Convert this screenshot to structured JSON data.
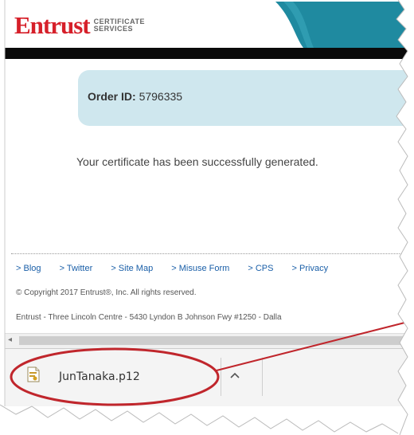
{
  "header": {
    "logo_word": "Entrust",
    "logo_sub_line1": "CERTIFICATE",
    "logo_sub_line2": "SERVICES"
  },
  "order": {
    "label": "Order ID:",
    "value": "5796335"
  },
  "message": "Your certificate has been successfully generated.",
  "footer": {
    "links": [
      "> Blog",
      "> Twitter",
      "> Site Map",
      "> Misuse Form",
      "> CPS",
      "> Privacy"
    ],
    "copyright": "© Copyright 2017 Entrust®, Inc. All rights reserved.",
    "address": "Entrust - Three Lincoln Centre - 5430 Lyndon B Johnson Fwy #1250 - Dalla"
  },
  "download": {
    "filename": "JunTanaka.p12",
    "icon": "certificate-file-icon",
    "menu_icon": "chevron-up-icon"
  },
  "colors": {
    "brand_red": "#d6202a",
    "header_teal": "#1f8aa0",
    "order_box": "#cfe7ee",
    "link_blue": "#1a5fa8",
    "callout_red": "#c0262c"
  }
}
